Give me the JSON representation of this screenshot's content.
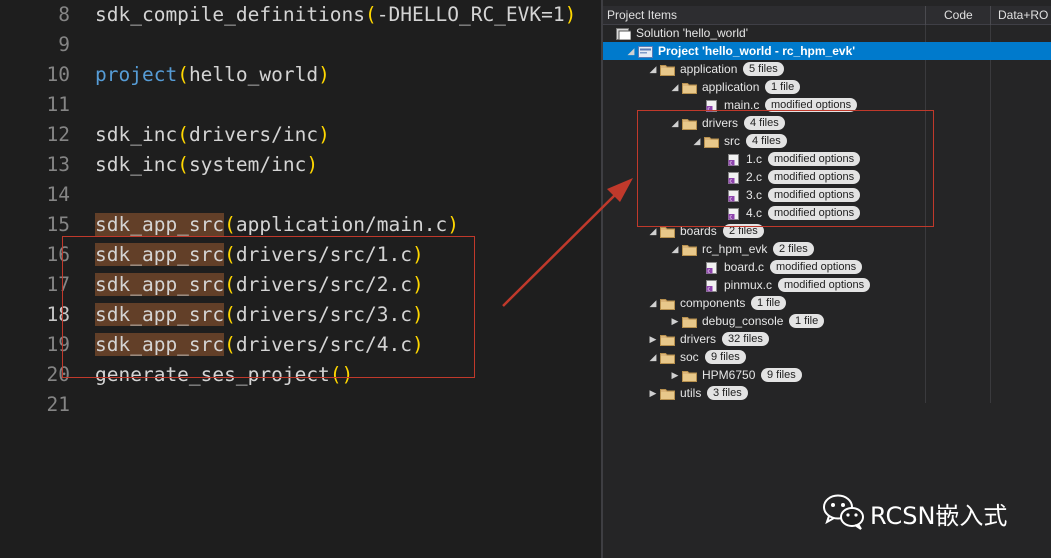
{
  "editor": {
    "lines": [
      {
        "num": "8",
        "segments": [
          {
            "t": "sdk_compile_definitions",
            "c": "plain"
          },
          {
            "t": "(",
            "c": "paren"
          },
          {
            "t": "-DHELLO_RC_EVK=1",
            "c": "plain"
          },
          {
            "t": ")",
            "c": "paren"
          }
        ]
      },
      {
        "num": "9",
        "segments": []
      },
      {
        "num": "10",
        "segments": [
          {
            "t": "project",
            "c": "kw"
          },
          {
            "t": "(",
            "c": "paren"
          },
          {
            "t": "hello_world",
            "c": "plain"
          },
          {
            "t": ")",
            "c": "paren"
          }
        ]
      },
      {
        "num": "11",
        "segments": []
      },
      {
        "num": "12",
        "segments": [
          {
            "t": "sdk_inc",
            "c": "plain"
          },
          {
            "t": "(",
            "c": "paren"
          },
          {
            "t": "drivers/inc",
            "c": "plain"
          },
          {
            "t": ")",
            "c": "paren"
          }
        ]
      },
      {
        "num": "13",
        "segments": [
          {
            "t": "sdk_inc",
            "c": "plain"
          },
          {
            "t": "(",
            "c": "paren"
          },
          {
            "t": "system/inc",
            "c": "plain"
          },
          {
            "t": ")",
            "c": "paren"
          }
        ]
      },
      {
        "num": "14",
        "segments": []
      },
      {
        "num": "15",
        "segments": [
          {
            "t": "sdk_app_src",
            "c": "hl"
          },
          {
            "t": "(",
            "c": "paren"
          },
          {
            "t": "application/main.c",
            "c": "plain"
          },
          {
            "t": ")",
            "c": "paren"
          }
        ]
      },
      {
        "num": "16",
        "segments": [
          {
            "t": "sdk_app_src",
            "c": "hl"
          },
          {
            "t": "(",
            "c": "paren"
          },
          {
            "t": "drivers/src/1.c",
            "c": "plain"
          },
          {
            "t": ")",
            "c": "paren"
          }
        ]
      },
      {
        "num": "17",
        "segments": [
          {
            "t": "sdk_app_src",
            "c": "hl"
          },
          {
            "t": "(",
            "c": "paren"
          },
          {
            "t": "drivers/src/2.c",
            "c": "plain"
          },
          {
            "t": ")",
            "c": "paren"
          }
        ]
      },
      {
        "num": "18",
        "active": true,
        "segments": [
          {
            "t": "sdk_app_src",
            "c": "hl"
          },
          {
            "t": "(",
            "c": "paren"
          },
          {
            "t": "drivers/src/3.c",
            "c": "plain"
          },
          {
            "t": ")",
            "c": "paren"
          }
        ]
      },
      {
        "num": "19",
        "segments": [
          {
            "t": "sdk_app_src",
            "c": "hl"
          },
          {
            "t": "(",
            "c": "paren"
          },
          {
            "t": "drivers/src/4.c",
            "c": "plain"
          },
          {
            "t": ")",
            "c": "paren"
          }
        ]
      },
      {
        "num": "20",
        "segments": [
          {
            "t": "generate_ses_project",
            "c": "plain"
          },
          {
            "t": "()",
            "c": "paren"
          }
        ]
      },
      {
        "num": "21",
        "segments": []
      }
    ]
  },
  "explorer": {
    "columns": {
      "items": "Project Items",
      "code": "Code",
      "data": "Data+RO"
    },
    "tree": [
      {
        "label": "Solution 'hello_world'",
        "depth": 0,
        "icon": "solution-icon",
        "expander": "none"
      },
      {
        "label": "Project 'hello_world - rc_hpm_evk'",
        "depth": 1,
        "icon": "project-icon",
        "expander": "expanded",
        "selected": true
      },
      {
        "label": "application",
        "depth": 2,
        "icon": "folder-icon",
        "expander": "expanded",
        "badge": "5 files"
      },
      {
        "label": "application",
        "depth": 3,
        "icon": "folder-icon",
        "expander": "expanded",
        "badge": "1 file"
      },
      {
        "label": "main.c",
        "depth": 4,
        "icon": "c-file-icon",
        "expander": "none",
        "badge": "modified options"
      },
      {
        "label": "drivers",
        "depth": 3,
        "icon": "folder-icon",
        "expander": "expanded",
        "badge": "4 files"
      },
      {
        "label": "src",
        "depth": 4,
        "icon": "folder-icon",
        "expander": "expanded",
        "badge": "4 files"
      },
      {
        "label": "1.c",
        "depth": 5,
        "icon": "c-file-icon",
        "expander": "none",
        "badge": "modified options"
      },
      {
        "label": "2.c",
        "depth": 5,
        "icon": "c-file-icon",
        "expander": "none",
        "badge": "modified options"
      },
      {
        "label": "3.c",
        "depth": 5,
        "icon": "c-file-icon",
        "expander": "none",
        "badge": "modified options"
      },
      {
        "label": "4.c",
        "depth": 5,
        "icon": "c-file-icon",
        "expander": "none",
        "badge": "modified options"
      },
      {
        "label": "boards",
        "depth": 2,
        "icon": "folder-icon",
        "expander": "expanded",
        "badge": "2 files"
      },
      {
        "label": "rc_hpm_evk",
        "depth": 3,
        "icon": "folder-icon",
        "expander": "expanded",
        "badge": "2 files"
      },
      {
        "label": "board.c",
        "depth": 4,
        "icon": "c-file-icon",
        "expander": "none",
        "badge": "modified options"
      },
      {
        "label": "pinmux.c",
        "depth": 4,
        "icon": "c-file-icon",
        "expander": "none",
        "badge": "modified options"
      },
      {
        "label": "components",
        "depth": 2,
        "icon": "folder-icon",
        "expander": "expanded",
        "badge": "1 file"
      },
      {
        "label": "debug_console",
        "depth": 3,
        "icon": "folder-icon",
        "expander": "collapsed",
        "badge": "1 file"
      },
      {
        "label": "drivers",
        "depth": 2,
        "icon": "folder-icon",
        "expander": "collapsed",
        "badge": "32 files"
      },
      {
        "label": "soc",
        "depth": 2,
        "icon": "folder-icon",
        "expander": "expanded",
        "badge": "9 files"
      },
      {
        "label": "HPM6750",
        "depth": 3,
        "icon": "folder-icon",
        "expander": "collapsed",
        "badge": "9 files"
      },
      {
        "label": "utils",
        "depth": 2,
        "icon": "folder-icon",
        "expander": "collapsed",
        "badge": "3 files"
      }
    ]
  },
  "watermark": {
    "text": "RCSN嵌入式",
    "icon": "wechat-icon"
  },
  "annotations": {
    "color": "#c0392b"
  },
  "colors": {
    "editor_bg": "#1e1e1e",
    "keyword": "#569cd6",
    "paren": "#ffd700",
    "highlight": "#623f28",
    "selection": "#007acc"
  }
}
